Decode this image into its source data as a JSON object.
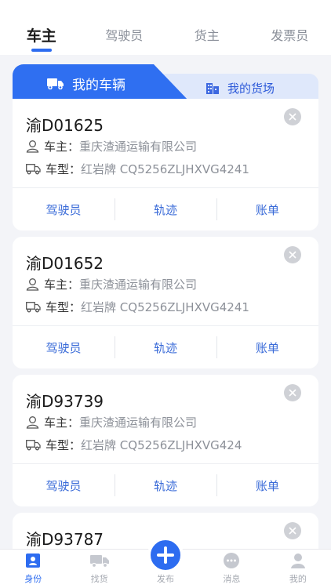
{
  "top_tabs": [
    {
      "label": "车主",
      "active": true
    },
    {
      "label": "驾驶员",
      "active": false
    },
    {
      "label": "货主",
      "active": false
    },
    {
      "label": "发票员",
      "active": false
    }
  ],
  "sub_tabs": {
    "vehicles_label": "我的车辆",
    "yards_label": "我的货场"
  },
  "labels": {
    "owner": "车主：",
    "model": "车型："
  },
  "vehicles": [
    {
      "plate": "渝D01625",
      "owner": "重庆渣通运输有限公司",
      "model": "红岩牌 CQ5256ZLJHXVG4241",
      "actions": [
        "驾驶员",
        "轨迹",
        "账单"
      ]
    },
    {
      "plate": "渝D01652",
      "owner": "重庆渣通运输有限公司",
      "model": "红岩牌 CQ5256ZLJHXVG4241",
      "actions": [
        "驾驶员",
        "轨迹",
        "账单"
      ]
    },
    {
      "plate": "渝D93739",
      "owner": "重庆渣通运输有限公司",
      "model": "红岩牌 CQ5256ZLJHXVG424",
      "actions": [
        "驾驶员",
        "轨迹",
        "账单"
      ]
    },
    {
      "plate": "渝D93787"
    }
  ],
  "bottom_nav": [
    {
      "label": "身份",
      "icon": "id-badge-icon",
      "active": true
    },
    {
      "label": "找货",
      "icon": "truck-icon",
      "active": false
    },
    {
      "label": "发布",
      "icon": "plus-icon",
      "active": false
    },
    {
      "label": "消息",
      "icon": "chat-icon",
      "active": false
    },
    {
      "label": "我的",
      "icon": "person-icon",
      "active": false
    }
  ],
  "colors": {
    "accent": "#2d6cf0",
    "tab_inactive_bg": "#dfe8fb",
    "action_text": "#3a6bd8",
    "muted_text": "#8d9199",
    "page_bg": "#f3f4f8"
  }
}
